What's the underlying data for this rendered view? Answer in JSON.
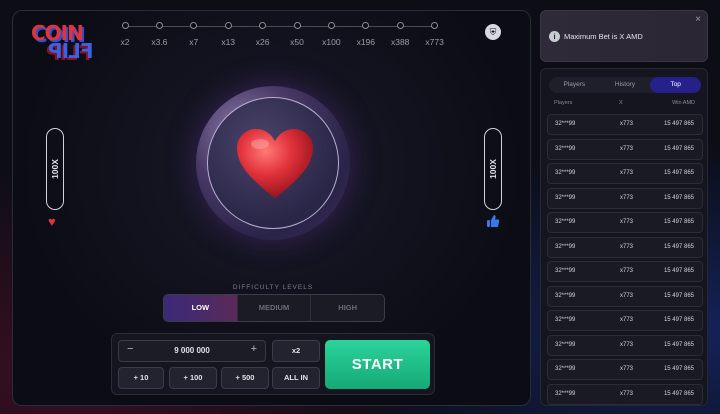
{
  "logo": {
    "line1": "COIN",
    "line2": "FLIP"
  },
  "multipliers": [
    "x2",
    "x3.6",
    "x7",
    "x13",
    "x26",
    "x50",
    "x100",
    "x196",
    "x388",
    "x773"
  ],
  "side": {
    "left_label": "100X",
    "right_label": "100X",
    "left_icon": "heart-icon",
    "right_icon": "thumbs-up-icon"
  },
  "difficulty": {
    "label": "DIFFICULTY LEVELS",
    "options": [
      "LOW",
      "MEDIUM",
      "HIGH"
    ],
    "selected": "LOW"
  },
  "bet": {
    "amount": "9 000 000",
    "minus": "−",
    "plus": "+",
    "x2": "x2",
    "p10": "+ 10",
    "p100": "+ 100",
    "p500": "+ 500",
    "allin": "ALL IN",
    "start": "START"
  },
  "toast": {
    "message": "Maximum Bet is X AMD",
    "close": "×",
    "info": "i"
  },
  "stats": {
    "tabs": [
      "Players",
      "History",
      "Top"
    ],
    "active_tab": "Top",
    "columns": [
      "Players",
      "X",
      "Win AMD"
    ],
    "rows": [
      {
        "player": "32***99",
        "x": "x773",
        "win": "15 497 865"
      },
      {
        "player": "32***99",
        "x": "x773",
        "win": "15 497 865"
      },
      {
        "player": "32***99",
        "x": "x773",
        "win": "15 497 865"
      },
      {
        "player": "32***99",
        "x": "x773",
        "win": "15 497 865"
      },
      {
        "player": "32***99",
        "x": "x773",
        "win": "15 497 865"
      },
      {
        "player": "32***99",
        "x": "x773",
        "win": "15 497 865"
      },
      {
        "player": "32***99",
        "x": "x773",
        "win": "15 497 865"
      },
      {
        "player": "32***99",
        "x": "x773",
        "win": "15 497 865"
      },
      {
        "player": "32***99",
        "x": "x773",
        "win": "15 497 865"
      },
      {
        "player": "32***99",
        "x": "x773",
        "win": "15 497 865"
      },
      {
        "player": "32***99",
        "x": "x773",
        "win": "15 497 865"
      },
      {
        "player": "32***99",
        "x": "x773",
        "win": "15 497 865"
      }
    ]
  },
  "colors": {
    "accent_red": "#e2333c",
    "accent_blue": "#3a62e8",
    "start_green": "#1fbf8a",
    "tab_active": "#26208a"
  }
}
